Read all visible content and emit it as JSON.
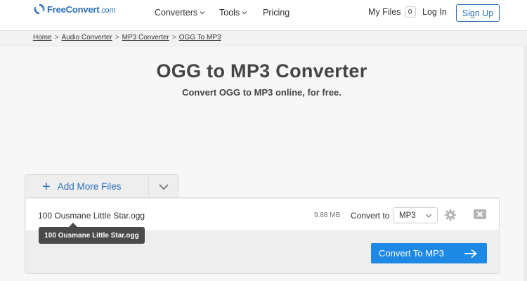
{
  "brand": {
    "name": "FreeConvert",
    "tld": ".com",
    "color": "#2b6fb6"
  },
  "nav": {
    "converters": "Converters",
    "tools": "Tools",
    "pricing": "Pricing",
    "my_files": "My Files",
    "my_files_count": "0",
    "login": "Log In",
    "signup": "Sign Up"
  },
  "breadcrumb": [
    "Home",
    "Audio Converter",
    "MP3 Converter",
    "OGG To MP3"
  ],
  "page": {
    "title": "OGG to MP3 Converter",
    "subtitle": "Convert OGG to MP3 online, for free."
  },
  "uploader": {
    "add_more_label": "Add More Files",
    "file": {
      "name": "100 Ousmane Little Star.ogg",
      "size": "9.88 MB",
      "convert_to_label": "Convert to",
      "format": "MP3"
    },
    "tooltip": "100 Ousmane Little Star.ogg",
    "convert_button": "Convert To MP3",
    "accent": "#1e88e5"
  },
  "icons": {
    "logo": "refresh-arrows-icon",
    "dropdown": "chevron-down-icon",
    "settings": "gear-icon",
    "remove": "close-icon",
    "submit": "arrow-right-icon",
    "add": "plus-icon"
  }
}
